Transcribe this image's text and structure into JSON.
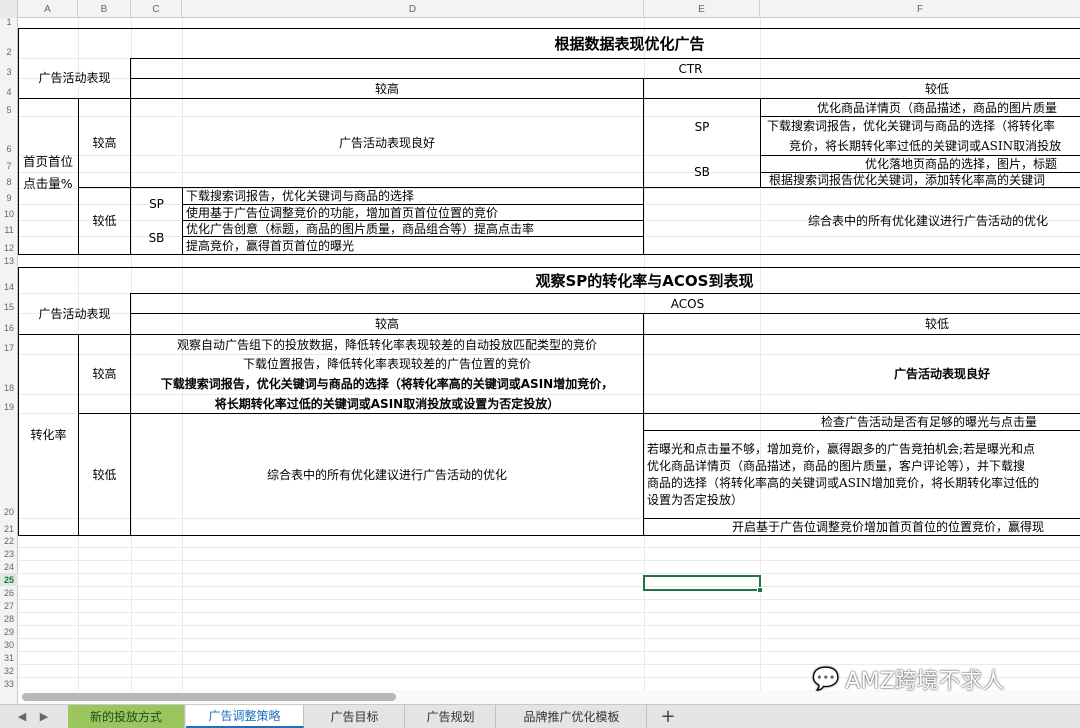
{
  "columns": [
    "A",
    "B",
    "C",
    "D",
    "E",
    "F"
  ],
  "rows": [
    "1",
    "2",
    "3",
    "4",
    "5",
    "6",
    "7",
    "8",
    "9",
    "10",
    "11",
    "12",
    "13",
    "14",
    "15",
    "16",
    "17",
    "18",
    "19",
    "20",
    "21",
    "22",
    "23",
    "24",
    "25",
    "26",
    "27",
    "28",
    "29",
    "30",
    "31",
    "32",
    "33"
  ],
  "selected_row": "25",
  "table1": {
    "title": "根据数据表现优化广告",
    "activity_label": "广告活动表现",
    "metric": "CTR",
    "high": "较高",
    "low": "较低",
    "row_label": "首页首位点击量%",
    "sp": "SP",
    "sb": "SB",
    "hh_text": "广告活动表现良好",
    "hl_sp_1": "优化商品详情页（商品描述，商品的图片质量",
    "hl_sp_2": "下载搜索词报告，优化关键词与商品的选择（将转化率",
    "hl_sp_3": "竞价，将长期转化率过低的关键词或ASIN取消投放",
    "hl_sb_1": "优化落地页商品的选择，图片，标题",
    "hl_sb_2": "根据搜索词报告优化关键词，添加转化率高的关键词",
    "lh_1": "下载搜索词报告，优化关键词与商品的选择",
    "lh_2": "使用基于广告位调整竞价的功能，增加首页首位位置的竞价",
    "lh_3": "优化广告创意（标题，商品的图片质量，商品组合等）提高点击率",
    "lh_4": "提高竞价，赢得首页首位的曝光",
    "ll_text": "综合表中的所有优化建议进行广告活动的优化"
  },
  "table2": {
    "title": "观察SP的转化率与ACOS到表现",
    "activity_label": "广告活动表现",
    "metric": "ACOS",
    "high": "较高",
    "low": "较低",
    "row_label": "转化率",
    "hh_1": "观察自动广告组下的投放数据，降低转化率表现较差的自动投放匹配类型的竞价",
    "hh_2": "下载位置报告，降低转化率表现较差的广告位置的竞价",
    "hh_3": "下载搜索词报告，优化关键词与商品的选择（将转化率高的关键词或ASIN增加竞价，",
    "hh_4": "将长期转化率过低的关键词或ASIN取消投放或设置为否定投放）",
    "hl_text": "广告活动表现良好",
    "lh_text": "综合表中的所有优化建议进行广告活动的优化",
    "ll_1": "检查广告活动是否有足够的曝光与点击量",
    "ll_2": "若曝光和点击量不够，增加竞价，赢得跟多的广告竞拍机会;若是曝光和点",
    "ll_3": "优化商品详情页（商品描述，商品的图片质量，客户评论等），并下载搜",
    "ll_4": "商品的选择（将转化率高的关键词或ASIN增加竞价，将长期转化率过低的",
    "ll_5": "设置为否定投放）",
    "ll_6": "开启基于广告位调整竞价增加首页首位的位置竞价，赢得现"
  },
  "tabs": [
    {
      "label": "新的投放方式",
      "state": "green"
    },
    {
      "label": "广告调整策略",
      "state": "active"
    },
    {
      "label": "广告目标",
      "state": "normal"
    },
    {
      "label": "广告规划",
      "state": "normal"
    },
    {
      "label": "品牌推广优化模板",
      "state": "normal"
    }
  ],
  "add_tab_label": "+",
  "nav_prev": "◀",
  "nav_next": "▶",
  "watermark": {
    "icon": "wechat-icon",
    "text": "AMZ跨境不求人"
  }
}
